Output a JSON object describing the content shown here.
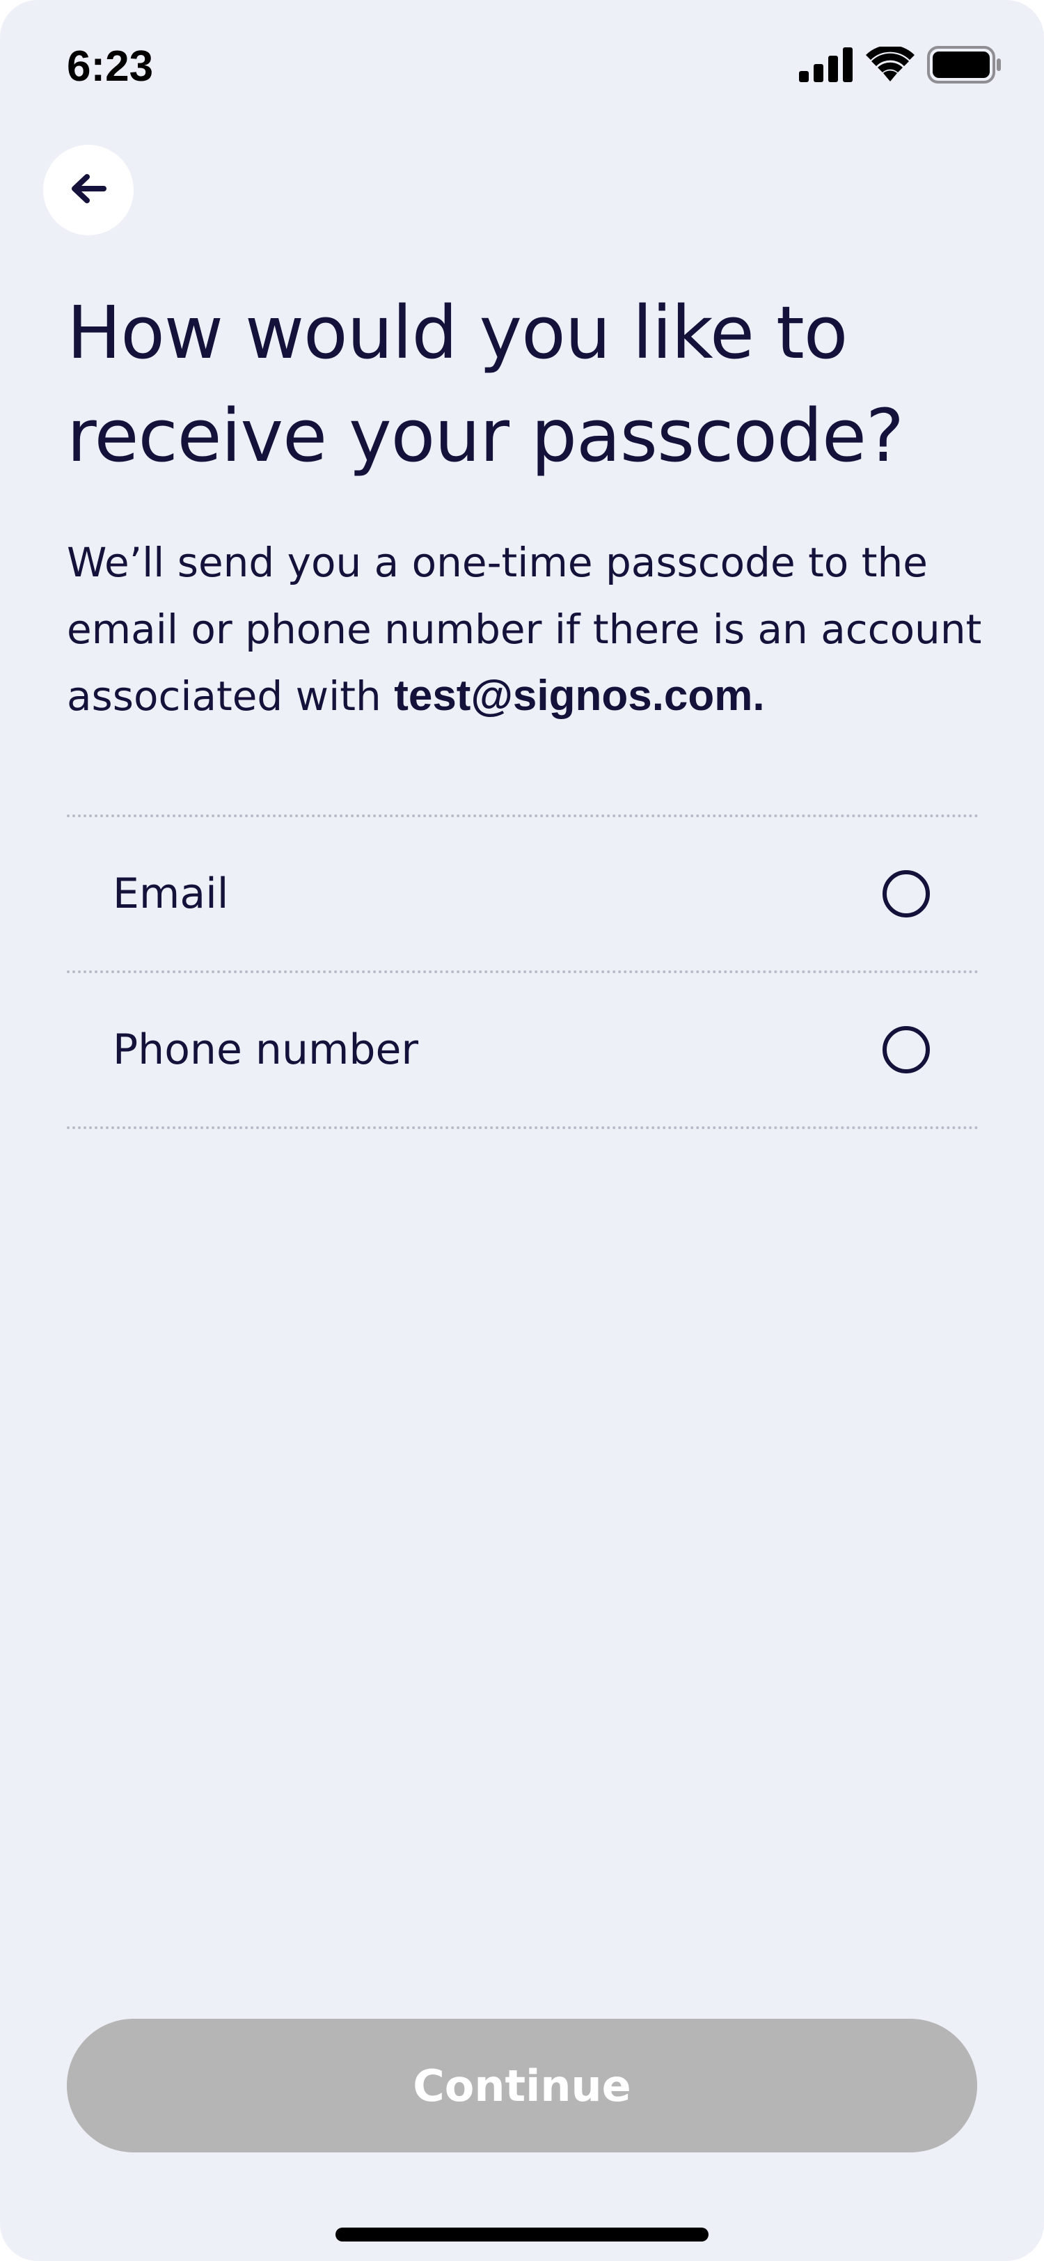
{
  "status_bar": {
    "time": "6:23",
    "signal_icon": "cellular-signal-icon",
    "wifi_icon": "wifi-icon",
    "battery_icon": "battery-icon",
    "battery_level": 1.0
  },
  "header": {
    "back_icon": "arrow-left-icon"
  },
  "main": {
    "title": "How would you like to receive your passcode?",
    "description_prefix": "We’ll send you a one-time passcode to the email or phone number if there is an account associated with ",
    "description_email": "test@signos.com."
  },
  "options": [
    {
      "label": "Email",
      "selected": false
    },
    {
      "label": "Phone number",
      "selected": false
    }
  ],
  "footer": {
    "continue_label": "Continue",
    "continue_disabled": true
  },
  "colors": {
    "background": "#EEF0F7",
    "text": "#14113A",
    "button_disabled": "#B5B5B5",
    "divider": "#B9BCC8"
  }
}
